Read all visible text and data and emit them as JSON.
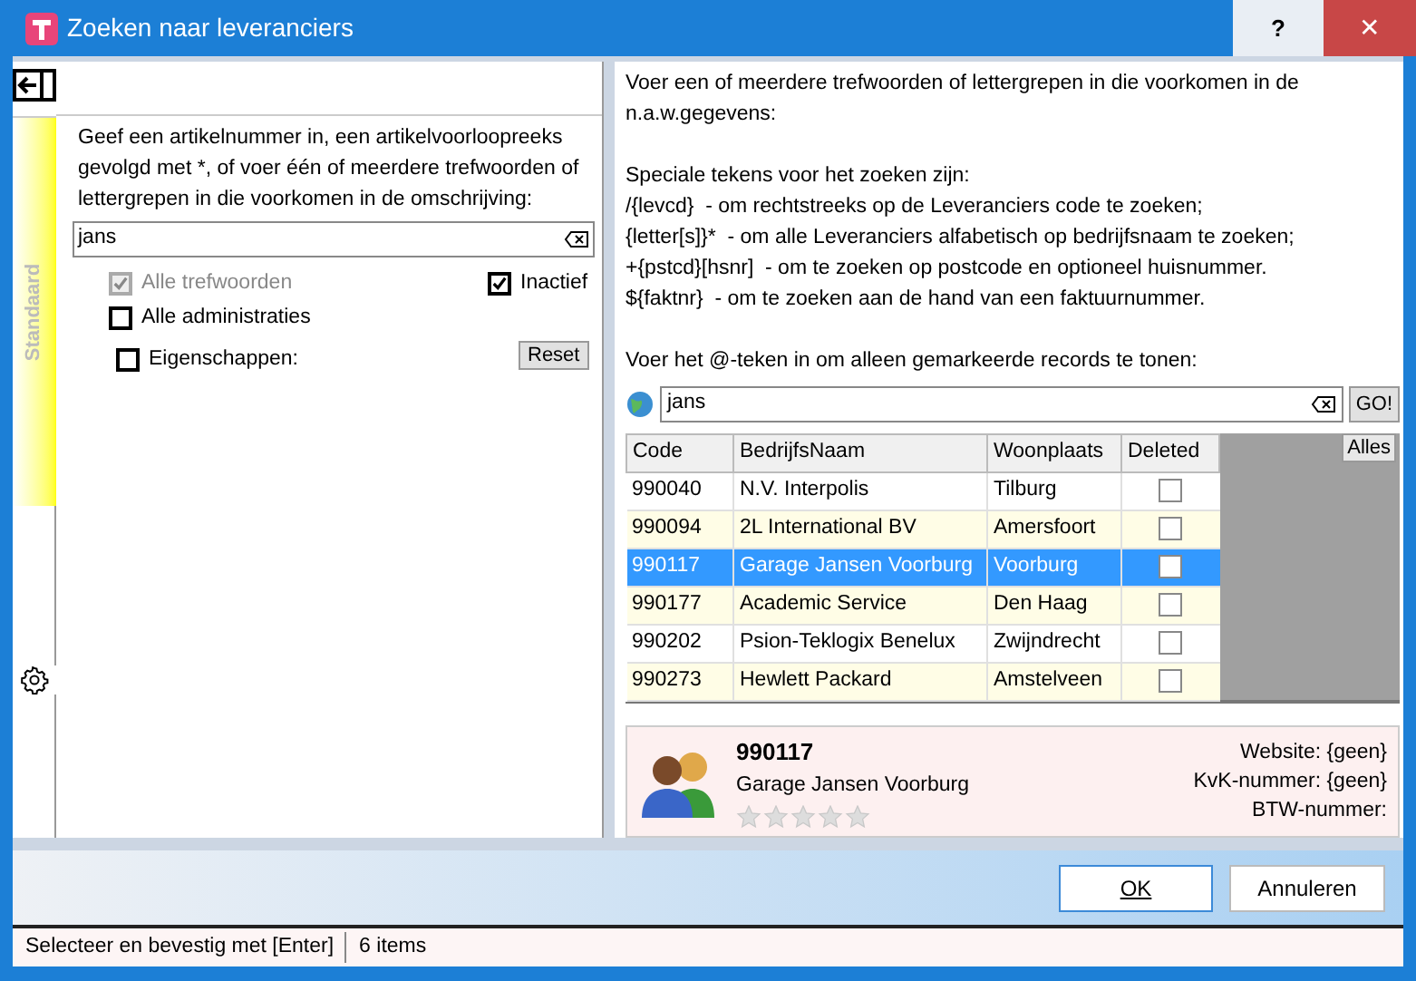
{
  "window": {
    "title": "Zoeken naar leveranciers",
    "buttons": [
      "?",
      "✕"
    ]
  },
  "left_panel": {
    "tabs": [
      {
        "label": "Standaard",
        "selected": true
      }
    ],
    "instructions": "Geef een artikelnummer in, een artikelvoorloopreeks gevolgd met *, of voer één of meerdere trefwoorden of lettergrepen in die voorkomen in de omschrijving:",
    "search": {
      "value": "jans"
    },
    "options": [
      {
        "label": "Alle trefwoorden",
        "checked": true,
        "disabled": true
      },
      {
        "label": "Inactief",
        "checked": true,
        "disabled": false
      },
      {
        "label": "Alle administraties",
        "checked": false,
        "disabled": false
      },
      {
        "label": "Eigenschappen:",
        "checked": false,
        "disabled": false
      }
    ],
    "reset_button": "Reset"
  },
  "help": {
    "paragraphs": [
      [
        "Voer een of meerdere trefwoorden of lettergrepen in die voorkomen in de n.a.w.gegevens:"
      ],
      [
        "Speciale tekens voor het zoeken zijn:",
        "/{levcd}  - om rechtstreeks op de Leveranciers code te zoeken;",
        "{letter[s]}*  - om alle Leveranciers alfabetisch op bedrijfsnaam te zoeken;",
        "+{pstcd}[hsnr]  - om te zoeken op postcode en optioneel huisnummer.",
        "${faktnr}  - om te zoeken aan de hand van een faktuurnummer."
      ],
      [
        "Voer het @-teken in om alleen gemarkeerde records te tonen:"
      ]
    ]
  },
  "search": {
    "value": "jans",
    "go_button": "GO!"
  },
  "table": {
    "all_button": "Alles",
    "columns": [
      "Code",
      "BedrijfsNaam",
      "Woonplaats",
      "Deleted"
    ],
    "rows": [
      {
        "code": "990040",
        "name": "N.V. Interpolis",
        "city": "Tilburg",
        "deleted": false,
        "selected": false
      },
      {
        "code": "990094",
        "name": "2L International BV",
        "city": "Amersfoort",
        "deleted": false,
        "selected": false
      },
      {
        "code": "990117",
        "name": "Garage Jansen Voorburg",
        "city": "Voorburg",
        "deleted": false,
        "selected": true
      },
      {
        "code": "990177",
        "name": "Academic Service",
        "city": "Den Haag",
        "deleted": false,
        "selected": false
      },
      {
        "code": "990202",
        "name": "Psion-Teklogix Benelux",
        "city": "Zwijndrecht",
        "deleted": false,
        "selected": false
      },
      {
        "code": "990273",
        "name": "Hewlett Packard",
        "city": "Amstelveen",
        "deleted": false,
        "selected": false
      }
    ]
  },
  "detail": {
    "code": "990117",
    "name": "Garage Jansen Voorburg",
    "stars": 0,
    "fields": [
      "Website: {geen}",
      "KvK-nummer: {geen}",
      "BTW-nummer:"
    ]
  },
  "buttons": [
    "OK",
    "Annuleren"
  ],
  "status_bar": [
    "Selecteer en bevestig met [Enter]",
    "6 items"
  ]
}
